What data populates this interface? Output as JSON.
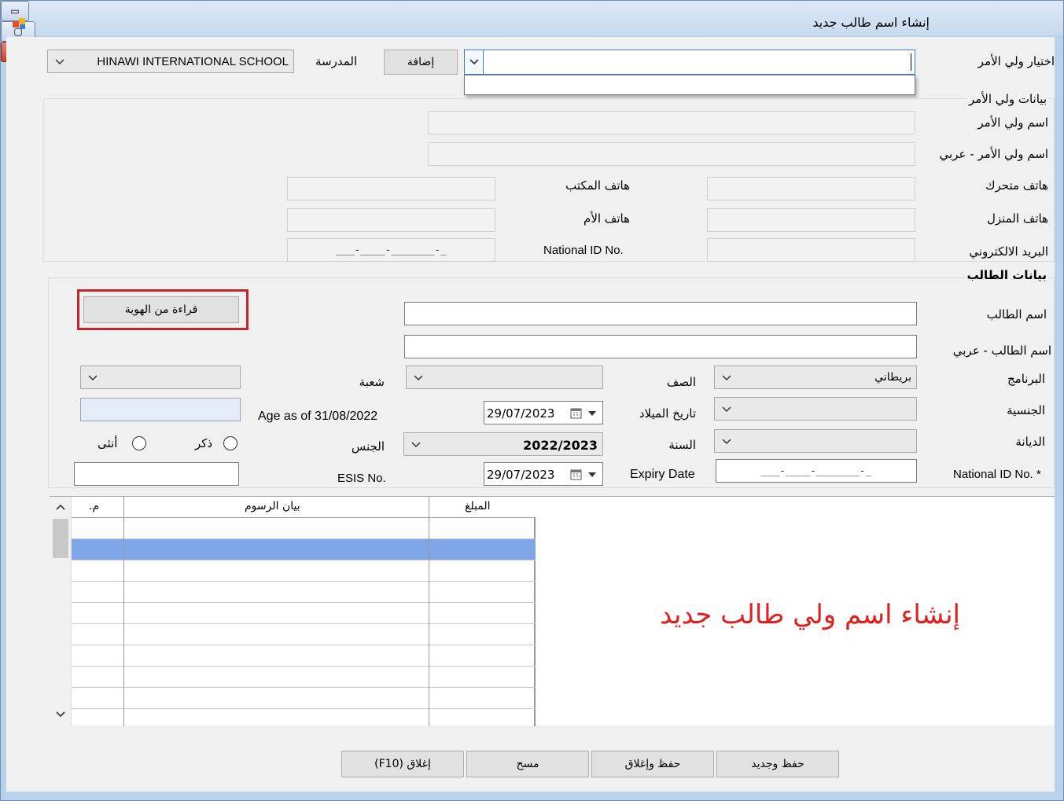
{
  "window": {
    "title": "إنشاء اسم طالب جديد",
    "buttons": {
      "close": "✕",
      "maximize": "▢",
      "minimize": "▭"
    }
  },
  "header": {
    "guardian_select_label": "اختيار ولي الأمر",
    "guardian_select_value": "",
    "add_button": "إضافة",
    "school_label": "المدرسة",
    "school_value": "HINAWI INTERNATIONAL SCHOOL"
  },
  "guardian": {
    "section_title": "بيانات ولي الأمر",
    "name_label": "اسم ولي الأمر",
    "name_ar_label": "اسم ولي الأمر - عربي",
    "mobile_label": "هاتف متحرك",
    "office_phone_label": "هاتف المكتب",
    "home_phone_label": "هاتف المنزل",
    "mother_phone_label": "هاتف الأم",
    "email_label": "البريد الالكتروني",
    "national_id_label": "National ID No.",
    "national_id_mask": "___-____-_______-_"
  },
  "student": {
    "section_title": "بيانات الطالب",
    "read_id_button": "قراءة من الهوية",
    "name_label": "اسم الطالب",
    "name_ar_label": "اسم الطالب - عربي",
    "program_label": "البرنامج",
    "program_value": "بريطاني",
    "grade_label": "الصف",
    "section_label": "شعبة",
    "nationality_label": "الجنسية",
    "birthdate_label": "تاريخ الميلاد",
    "birthdate_value": "29/07/2023",
    "age_label": "Age as of 31/08/2022",
    "religion_label": "الديانة",
    "year_label": "السنة",
    "year_value": "2022/2023",
    "gender_label": "الجنس",
    "male_label": "ذكر",
    "female_label": "أنثى",
    "national_id_label": "National ID No. *",
    "national_id_mask": "___-____-_______-_",
    "expiry_label": "Expiry Date",
    "expiry_value": "29/07/2023",
    "esis_label": "ESIS No."
  },
  "fees_grid": {
    "columns": [
      "المبلغ",
      "بيان الرسوم",
      "م."
    ],
    "rows": 9,
    "selected_row": 1
  },
  "annotation_text": "إنشاء اسم ولي طالب جديد",
  "footer": {
    "save_new": "حفظ وجديد",
    "save_close": "حفظ وإغلاق",
    "clear": "مسح",
    "close": "إغلاق (F10)"
  },
  "colors": {
    "window_frame": "#b9d1ea",
    "selected_row": "#7fa7e8",
    "highlight_box": "#c0272d",
    "annotation": "#e02020"
  }
}
